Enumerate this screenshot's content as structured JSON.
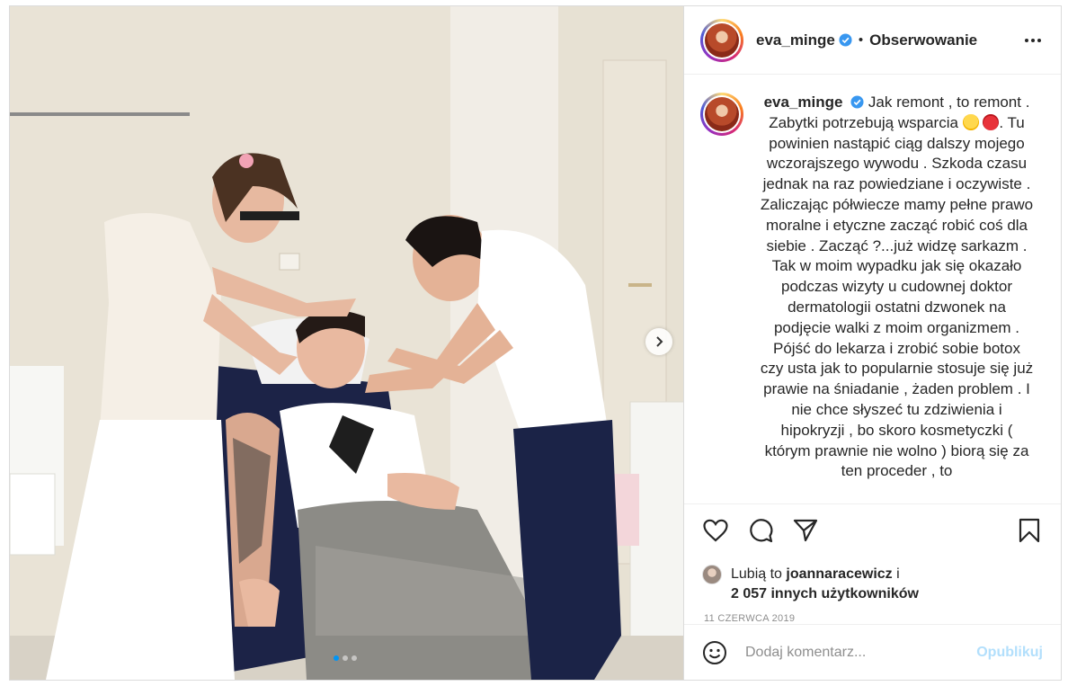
{
  "post": {
    "username": "eva_minge",
    "follow_label": "Obserwowanie",
    "separator": "•",
    "caption": "Jak remont , to remont . Zabytki potrzebują wsparcia",
    "caption_cont_1": ". Tu powinien nastąpić ciąg dalszy mojego wczorajszego wywodu . Szkoda czasu jednak na raz powiedziane i oczywiste . Zaliczając półwiecze mamy pełne prawo moralne i etyczne zacząć robić coś dla siebie . Zacząć ?...już widzę sarkazm . Tak w moim wypadku jak się okazało podczas wizyty u cudownej doktor dermatologii ostatni dzwonek na podjęcie walki z moim organizmem . Pójść do lekarza i zrobić sobie botox czy usta jak to popularnie stosuje się już prawie na śniadanie , żaden problem . I nie chce słyszeć tu zdziwienia i hipokryzji , bo skoro kosmetyczki ( którym prawnie nie wolno ) biorą się za ten proceder , to",
    "emoji_1": "smiling-face-with-tears-of-joy",
    "emoji_2": "smiling-face-with-horns",
    "verified_icon": "verified-badge-icon"
  },
  "likes": {
    "prefix": "Lubią to",
    "user": "joannaracewicz",
    "conj": "i",
    "others": "2 057 innych użytkowników"
  },
  "date": "11 CZERWCA 2019",
  "comment": {
    "placeholder": "Dodaj komentarz...",
    "publish_label": "Opublikuj"
  },
  "carousel": {
    "total": 3,
    "active_index": 0
  },
  "colors": {
    "accent_blue": "#0095f6",
    "verified_blue": "#3897f0",
    "publish_disabled": "#b2dffc",
    "text": "#262626",
    "muted": "#8e8e8e"
  }
}
